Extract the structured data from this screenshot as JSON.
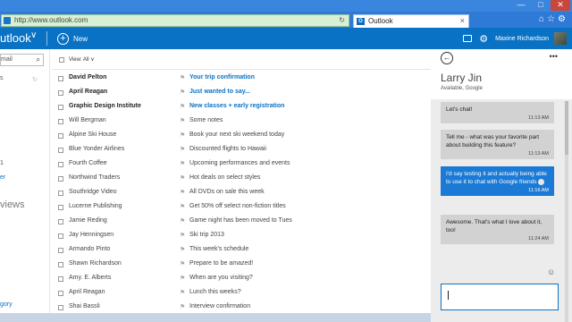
{
  "browser": {
    "url": "http://www.outlook.com",
    "tab_title": "Outlook",
    "tab_close": "×",
    "window_controls": [
      "—",
      "□",
      "✕"
    ],
    "toolbar_icons": "⌂☆⚙"
  },
  "app": {
    "title": "utlook",
    "new_label": "New",
    "new_symbol": "+",
    "user_name": "Maxine Richardson"
  },
  "left_pane": {
    "search_text": "mail",
    "items": [
      {
        "text": "s",
        "link": false
      },
      {
        "text": "1",
        "link": false
      },
      {
        "text": "er",
        "link": true
      },
      {
        "text": "views",
        "link": false
      },
      {
        "text": "gory",
        "link": true
      }
    ]
  },
  "list": {
    "view_all": "View: All ∨",
    "rows": [
      {
        "sender": "David Pelton",
        "subject": "Your trip confirmation",
        "unread": true
      },
      {
        "sender": "April Reagan",
        "subject": "Just wanted to say...",
        "unread": true
      },
      {
        "sender": "Graphic Design Institute",
        "subject": "New classes + early registration",
        "unread": true
      },
      {
        "sender": "Will Bergman",
        "subject": "Some notes",
        "unread": false
      },
      {
        "sender": "Alpine Ski House",
        "subject": "Book your next ski weekend today",
        "unread": false
      },
      {
        "sender": "Blue Yonder Airlines",
        "subject": "Discounted flights to Hawaii",
        "unread": false
      },
      {
        "sender": "Fourth Coffee",
        "subject": "Upcoming performances and events",
        "unread": false
      },
      {
        "sender": "Northwind Traders",
        "subject": "Hot deals on select styles",
        "unread": false
      },
      {
        "sender": "Southridge Video",
        "subject": "All DVDs on sale this week",
        "unread": false
      },
      {
        "sender": "Lucerne Publishing",
        "subject": "Get 50% off select non-fiction titles",
        "unread": false
      },
      {
        "sender": "Jamie Reding",
        "subject": "Game night has been moved to Tues",
        "unread": false
      },
      {
        "sender": "Jay Henningsen",
        "subject": "Ski trip 2013",
        "unread": false
      },
      {
        "sender": "Armando Pinto",
        "subject": "This week's schedule",
        "unread": false
      },
      {
        "sender": "Shawn Richardson",
        "subject": "Prepare to be amazed!",
        "unread": false
      },
      {
        "sender": "Amy. E. Alberts",
        "subject": "When are you visiting?",
        "unread": false
      },
      {
        "sender": "April Reagan",
        "subject": "Lunch this weeks?",
        "unread": false
      },
      {
        "sender": "Shai Bassli",
        "subject": "Interview confirmation",
        "unread": false
      }
    ]
  },
  "chat": {
    "contact_name": "Larry Jin",
    "status": "Available, Google",
    "messages": [
      {
        "text": "Let's chat!",
        "time": "11:13 AM",
        "outgoing": false
      },
      {
        "text": "Tell me - what was your favorite part about building this feature?",
        "time": "11:13 AM",
        "outgoing": false
      },
      {
        "text": "I'd say testing it and actually being able to use it to chat with Google friends",
        "time": "11:16 AM",
        "outgoing": true
      },
      {
        "text": "Awesome. That's what I love about it, too!",
        "time": "11:24 AM",
        "outgoing": false
      }
    ]
  },
  "colors": {
    "accent": "#0a72c4",
    "outgoing_bubble": "#1a7ad6",
    "incoming_bubble": "#d2d2d2"
  }
}
